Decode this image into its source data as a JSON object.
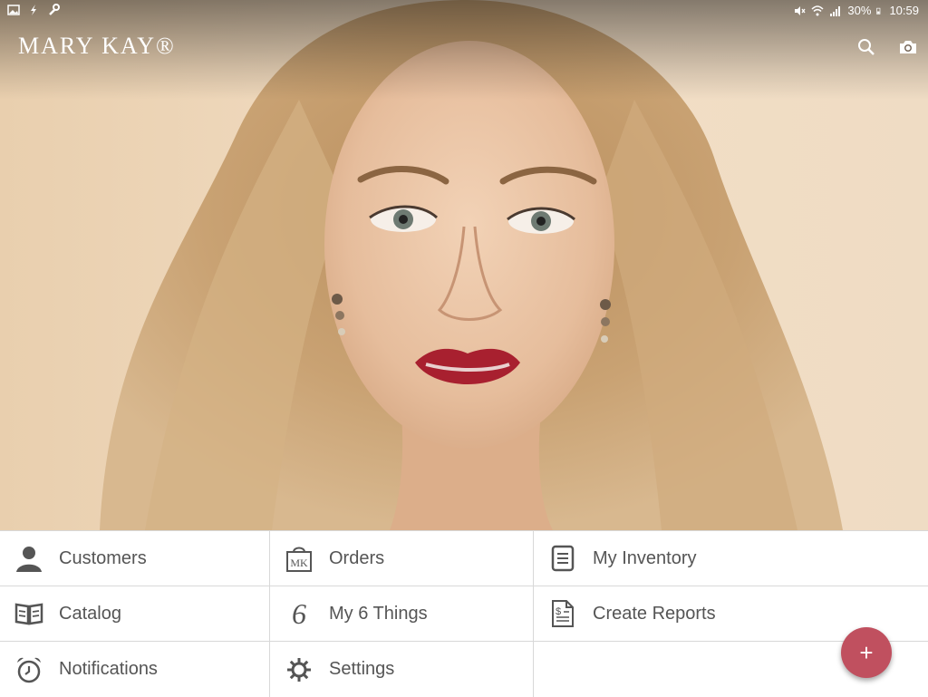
{
  "status_bar": {
    "battery": "30%",
    "time": "10:59"
  },
  "app": {
    "brand": "MARY KAY®"
  },
  "menu": {
    "items": [
      {
        "label": "Customers",
        "icon": "person-icon"
      },
      {
        "label": "Orders",
        "icon": "mk-bag-icon",
        "icon_text": "MK"
      },
      {
        "label": "My Inventory",
        "icon": "list-icon"
      },
      {
        "label": "Catalog",
        "icon": "book-icon"
      },
      {
        "label": "My 6 Things",
        "icon": "six-icon",
        "icon_text": "6"
      },
      {
        "label": "Create Reports",
        "icon": "report-icon",
        "icon_text": "$"
      },
      {
        "label": "Notifications",
        "icon": "alarm-clock-icon"
      },
      {
        "label": "Settings",
        "icon": "gear-icon"
      }
    ]
  },
  "fab": {
    "label": "+",
    "color": "#c0505f"
  }
}
